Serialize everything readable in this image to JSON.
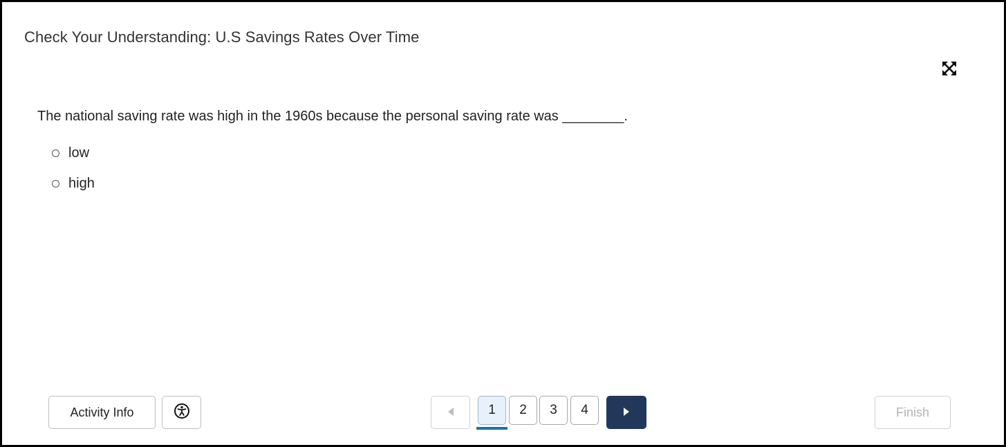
{
  "header": {
    "title": "Check Your Understanding: U.S Savings Rates Over Time"
  },
  "toolbar": {
    "expand_icon": "expand-arrows-icon"
  },
  "question": {
    "text": "The national saving rate was high in the 1960s because the personal saving rate was ________.",
    "options": [
      {
        "label": "low",
        "selected": false
      },
      {
        "label": "high",
        "selected": false
      }
    ]
  },
  "footer": {
    "activity_info_label": "Activity Info",
    "accessibility_icon": "accessibility-icon",
    "prev_icon": "triangle-left-icon",
    "pages": [
      "1",
      "2",
      "3",
      "4"
    ],
    "current_page": "1",
    "next_icon": "triangle-right-icon",
    "finish_label": "Finish"
  },
  "colors": {
    "next_button_bg": "#22385a",
    "current_page_bg": "#e6f1fb",
    "current_page_underline": "#1a73a8",
    "finish_disabled_text": "#b3b3b3"
  }
}
